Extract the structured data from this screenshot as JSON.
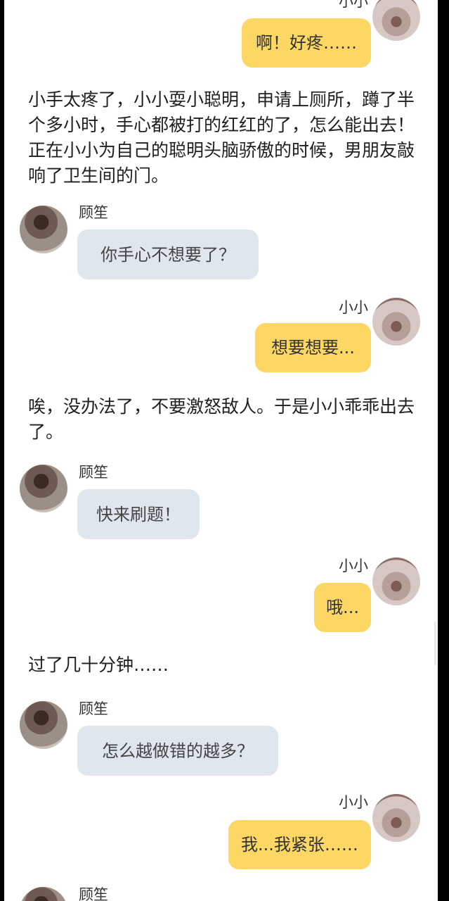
{
  "messages": {
    "m1": {
      "name": "小小",
      "text": "啊！好疼……"
    },
    "m2": {
      "name": "顾笙",
      "text": "你手心不想要了？"
    },
    "m3": {
      "name": "小小",
      "text": "想要想要..."
    },
    "m4": {
      "name": "顾笙",
      "text": "快来刷题！"
    },
    "m5": {
      "name": "小小",
      "text": "哦..."
    },
    "m6": {
      "name": "顾笙",
      "text": "怎么越做错的越多？"
    },
    "m7": {
      "name": "小小",
      "text": "我...我紧张……"
    },
    "m8": {
      "name": "顾笙"
    }
  },
  "narration": {
    "n1": "小手太疼了，小小耍小聪明，申请上厕所，蹲了半个多小时，手心都被打的红红的了，怎么能出去！正在小小为自己的聪明头脑骄傲的时候，男朋友敲响了卫生间的门。",
    "n2": "唉，没办法了，不要激怒敌人。于是小小乖乖出去了。",
    "n3": "过了几十分钟……"
  }
}
